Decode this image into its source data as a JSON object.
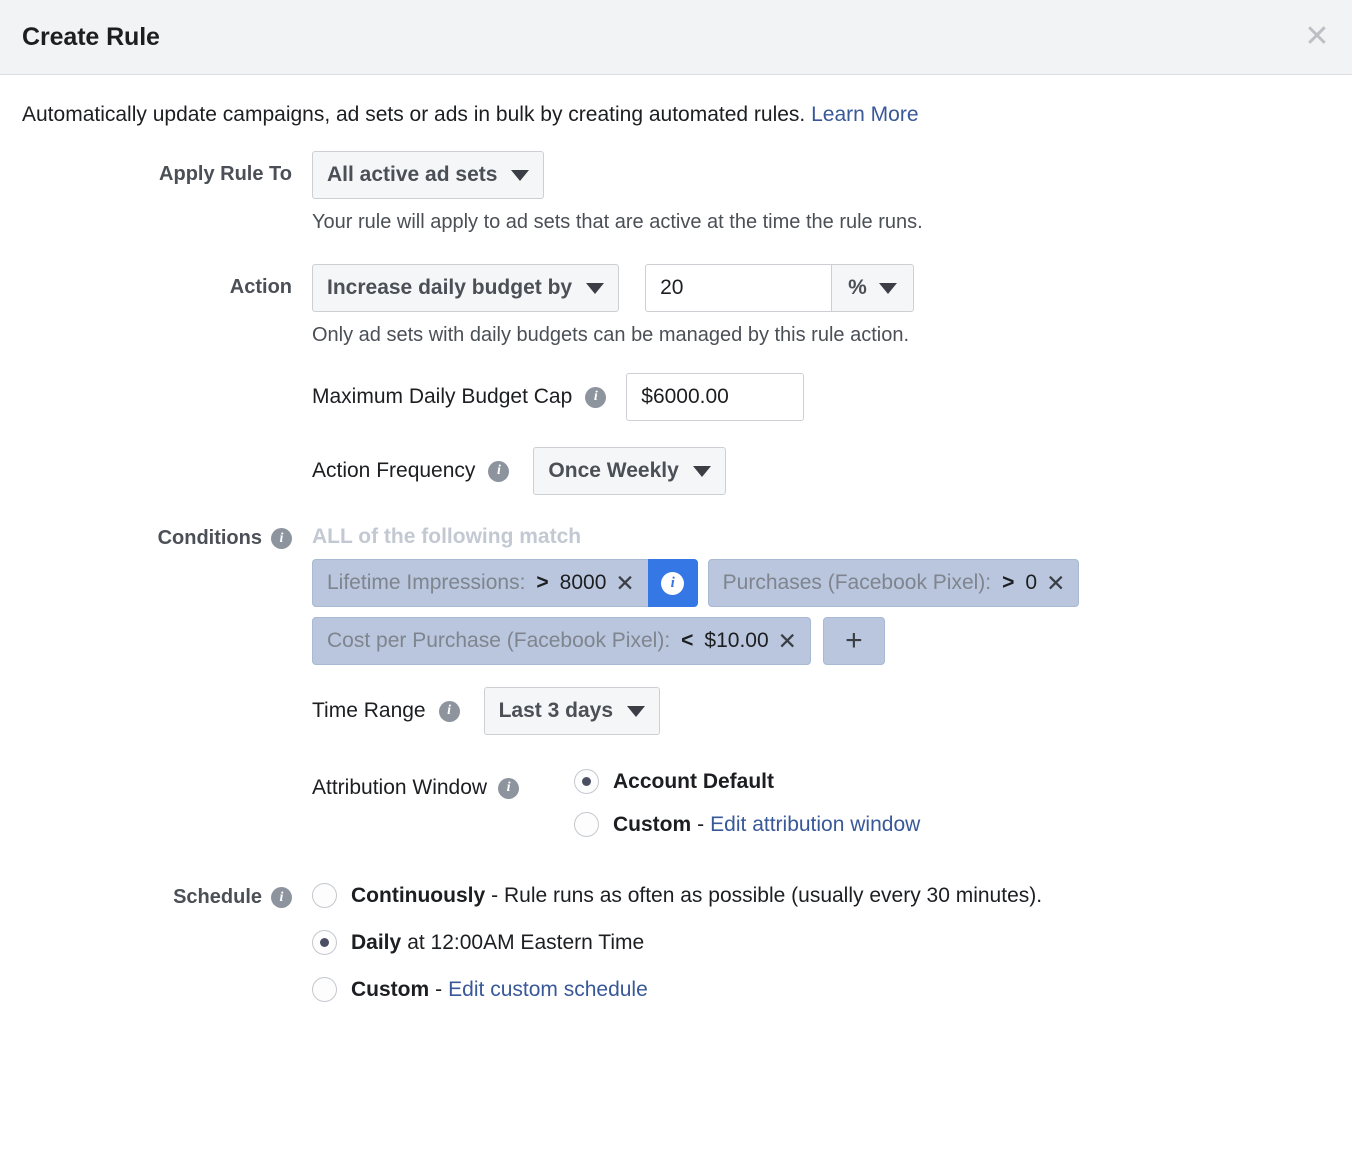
{
  "header": {
    "title": "Create Rule",
    "close_icon": "close-icon"
  },
  "intro": {
    "text": "Automatically update campaigns, ad sets or ads in bulk by creating automated rules.",
    "link_label": "Learn More"
  },
  "apply_rule_to": {
    "label": "Apply Rule To",
    "value": "All active ad sets",
    "help": "Your rule will apply to ad sets that are active at the time the rule runs."
  },
  "action": {
    "label": "Action",
    "value": "Increase daily budget by",
    "amount": "20",
    "unit": "%",
    "help": "Only ad sets with daily budgets can be managed by this rule action.",
    "budget_cap": {
      "label": "Maximum Daily Budget Cap",
      "info_icon": "info-icon",
      "value": "$6000.00"
    },
    "frequency": {
      "label": "Action Frequency",
      "info_icon": "info-icon",
      "value": "Once Weekly"
    }
  },
  "conditions": {
    "label": "Conditions",
    "info_icon": "info-icon",
    "match_heading": "ALL of the following match",
    "pills": [
      {
        "name": "Lifetime Impressions:",
        "operator": ">",
        "value": "8000",
        "remove_icon": "close-icon"
      },
      {
        "name": "Purchases (Facebook Pixel):",
        "operator": ">",
        "value": "0",
        "remove_icon": "close-icon"
      },
      {
        "name": "Cost per Purchase (Facebook Pixel):",
        "operator": "<",
        "value": "$10.00",
        "remove_icon": "close-icon"
      }
    ],
    "pill_info_icon": "info-icon",
    "add_label": "+"
  },
  "time_range": {
    "label": "Time Range",
    "info_icon": "info-icon",
    "value": "Last 3 days"
  },
  "attribution_window": {
    "label": "Attribution Window",
    "info_icon": "info-icon",
    "options": [
      {
        "strong": "Account Default",
        "rest": "",
        "link": "",
        "selected": true
      },
      {
        "strong": "Custom",
        "rest": " - ",
        "link": "Edit attribution window",
        "selected": false
      }
    ]
  },
  "schedule": {
    "label": "Schedule",
    "info_icon": "info-icon",
    "options": [
      {
        "strong": "Continuously",
        "rest": " - Rule runs as often as possible (usually every 30 minutes).",
        "link": "",
        "selected": false
      },
      {
        "strong": "Daily",
        "rest": " at 12:00AM Eastern Time",
        "link": "",
        "selected": true
      },
      {
        "strong": "Custom",
        "rest": " - ",
        "link": "Edit custom schedule",
        "selected": false
      }
    ]
  },
  "colors": {
    "accent_blue": "#3578e5",
    "link_blue": "#385898",
    "pill_bg": "#b9c6dd",
    "header_bg": "#f2f3f5",
    "control_bg": "#f5f6f7"
  }
}
